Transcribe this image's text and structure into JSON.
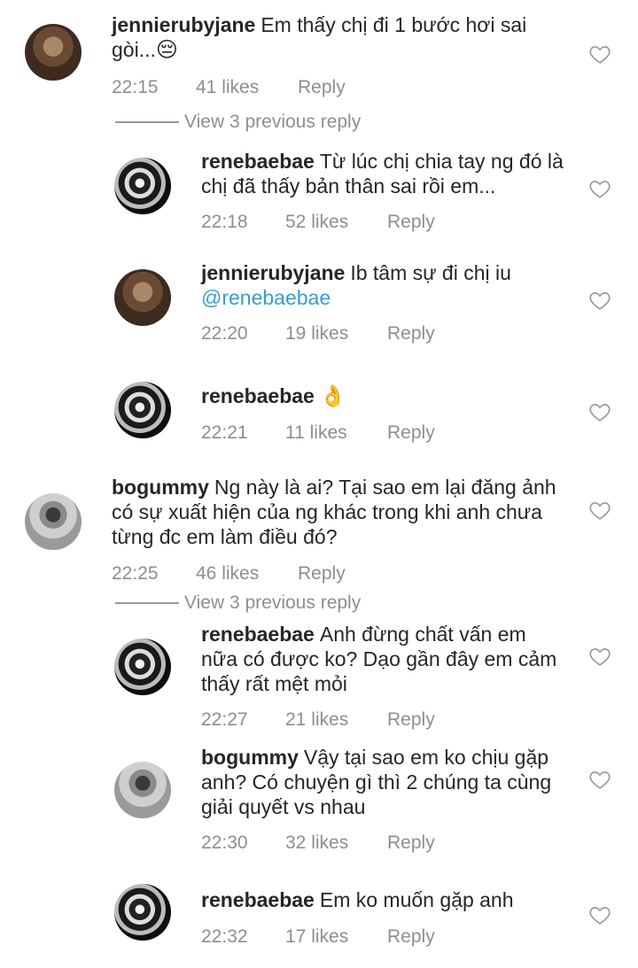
{
  "comments": [
    {
      "user": "jennierubyjane",
      "text": "Em thấy chị đi 1 bước hơi sai gòi...",
      "emoji": "😔",
      "time": "22:15",
      "likes": "41 likes",
      "reply": "Reply"
    },
    {
      "user": "renebaebae",
      "text": "Từ lúc chị chia tay ng đó là chị đã thấy bản thân sai rồi em...",
      "time": "22:18",
      "likes": "52 likes",
      "reply": "Reply"
    },
    {
      "user": "jennierubyjane",
      "text": "Ib tâm sự đi chị iu",
      "mention": "@renebaebae",
      "time": "22:20",
      "likes": "19 likes",
      "reply": "Reply"
    },
    {
      "user": "renebaebae",
      "emoji": "👌",
      "time": "22:21",
      "likes": "11 likes",
      "reply": "Reply"
    },
    {
      "user": "bogummy",
      "text": "Ng này là ai? Tại sao em lại đăng ảnh có sự xuất hiện của ng khác trong khi anh chưa từng đc em làm điều đó?",
      "time": "22:25",
      "likes": "46 likes",
      "reply": "Reply"
    },
    {
      "user": "renebaebae",
      "text": "Anh đừng chất vấn em nữa có được ko? Dạo gần đây em cảm thấy rất mệt mỏi",
      "time": "22:27",
      "likes": "21 likes",
      "reply": "Reply"
    },
    {
      "user": "bogummy",
      "text": "Vậy tại sao em ko chịu gặp anh? Có chuyện gì thì 2 chúng ta cùng giải quyết vs nhau",
      "time": "22:30",
      "likes": "32 likes",
      "reply": "Reply"
    },
    {
      "user": "renebaebae",
      "text": "Em ko muốn gặp anh",
      "time": "22:32",
      "likes": "17 likes",
      "reply": "Reply"
    }
  ],
  "view_previous": [
    "View 3 previous reply",
    "View 3 previous reply"
  ],
  "icons": {
    "heart": "heart-outline-icon"
  }
}
